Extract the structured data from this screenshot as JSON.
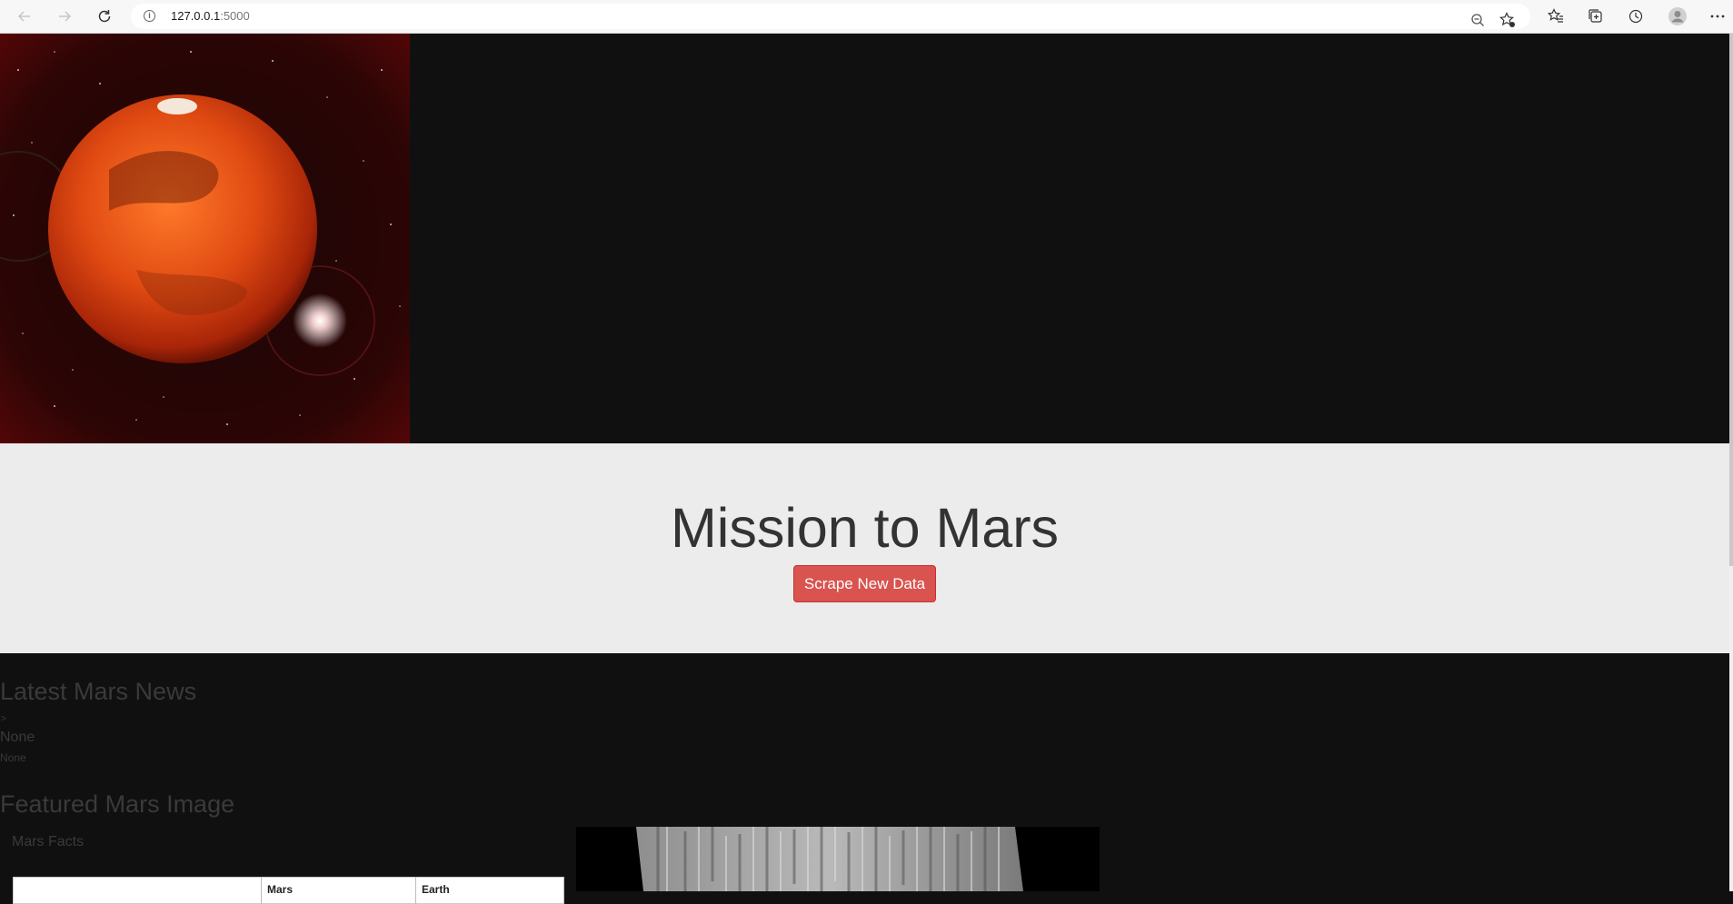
{
  "browser": {
    "url_host": "127.0.0.1",
    "url_port": ":5000",
    "icons": [
      "back-icon",
      "forward-icon",
      "reload-icon",
      "info-icon",
      "zoom-out-icon",
      "favorite-add-icon",
      "favorites-icon",
      "collections-icon",
      "history-icon",
      "profile-icon",
      "more-icon"
    ]
  },
  "jumbotron": {
    "title": "Mission to Mars",
    "button_label": "Scrape New Data",
    "button_color": "#d9534f"
  },
  "news": {
    "heading": "Latest Mars News",
    "caret": ">",
    "title": "None",
    "paragraph": "None"
  },
  "featured": {
    "heading": "Featured Mars Image"
  },
  "facts": {
    "label": "Mars Facts",
    "columns": [
      "",
      "Mars",
      "Earth"
    ]
  },
  "colors": {
    "page_bg": "#101010",
    "jumbotron_bg": "#ececec",
    "accent": "#d9534f"
  }
}
